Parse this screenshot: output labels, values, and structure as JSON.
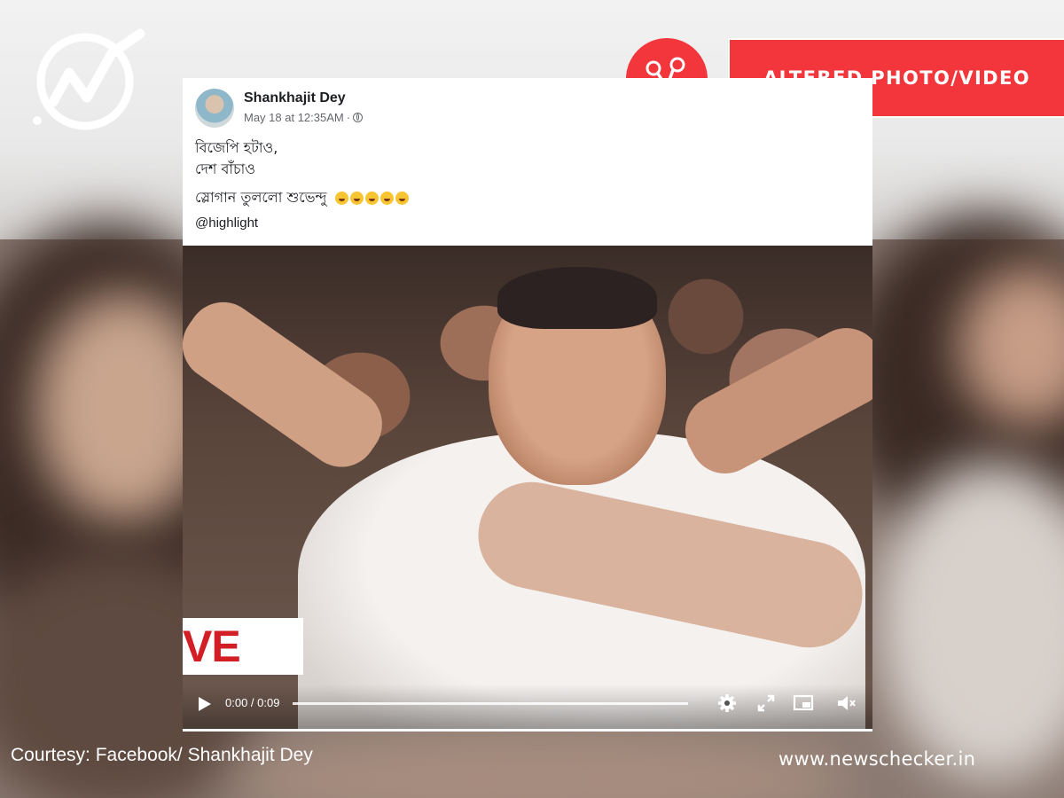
{
  "badge": {
    "label": "ALTERED PHOTO/VIDEO"
  },
  "post": {
    "author": "Shankhajit Dey",
    "timestamp": "May 18 at 12:35AM",
    "line1": "বিজেপি হটাও,",
    "line2": "দেশ বাঁচাও",
    "line3": "স্লোগান তুললো শুভেন্দু",
    "mention": "@highlight"
  },
  "video": {
    "live_text": "VE",
    "time": "0:00 / 0:09",
    "progress_fraction": 0
  },
  "footer": {
    "courtesy": "Courtesy: Facebook/ Shankhajit Dey",
    "site": "www.newschecker.in"
  },
  "colors": {
    "accent_red": "#f2363b",
    "text_dark": "#1c1e21",
    "meta_gray": "#65676b"
  },
  "icons": [
    "newschecker-logo",
    "scissors-icon",
    "globe-icon",
    "play-icon",
    "gear-icon",
    "fullscreen-icon",
    "pip-icon",
    "volume-icon"
  ]
}
